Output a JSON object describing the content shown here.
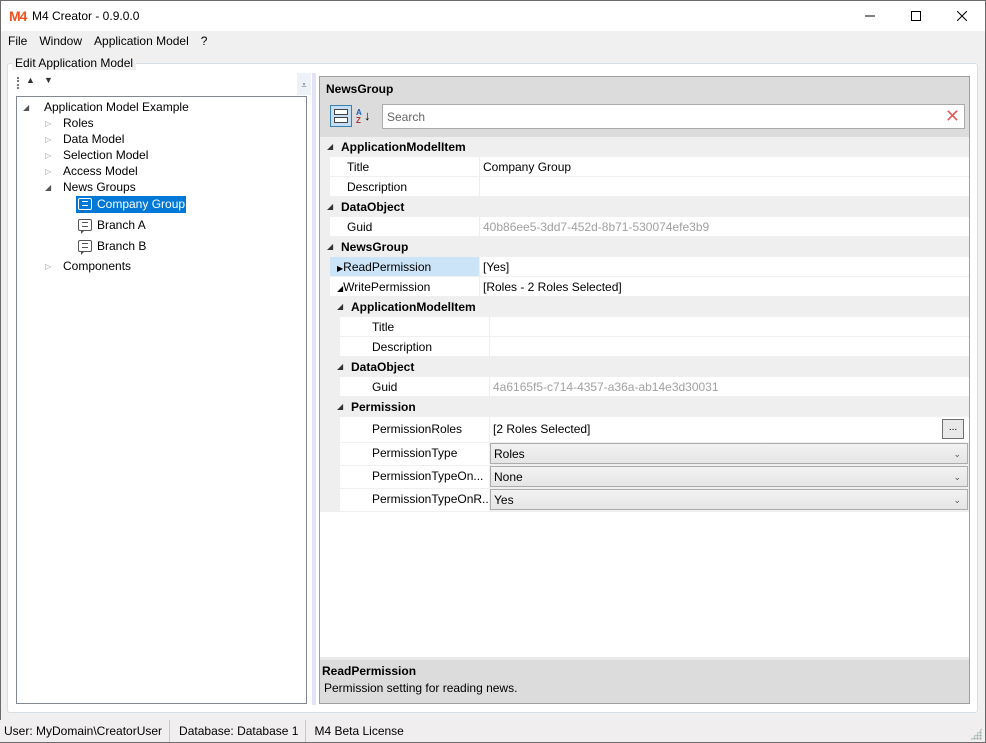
{
  "window": {
    "logo": "M4",
    "title": "M4 Creator - 0.9.0.0",
    "controls": {
      "minimize": "minimize-icon",
      "maximize": "maximize-icon",
      "close": "close-icon"
    }
  },
  "menu": [
    "File",
    "Window",
    "Application Model",
    "?"
  ],
  "group_label": "Edit Application Model",
  "tree_toolbar": {
    "up": "▲",
    "down": "▼",
    "overflow": "⩡"
  },
  "tree": {
    "root": "Application Model Example",
    "children": [
      "Roles",
      "Data Model",
      "Selection Model",
      "Access Model",
      "News Groups",
      "Components"
    ],
    "news_groups": [
      "Company Group",
      "Branch A",
      "Branch B"
    ],
    "selected": "Company Group"
  },
  "property_grid": {
    "title": "NewsGroup",
    "search_placeholder": "Search",
    "sections": {
      "ami": "ApplicationModelItem",
      "do": "DataObject",
      "ng": "NewsGroup",
      "ami2": "ApplicationModelItem",
      "do2": "DataObject",
      "perm": "Permission"
    },
    "props": {
      "title_name": "Title",
      "title_val": "Company Group",
      "desc_name": "Description",
      "desc_val": "",
      "guid_name": "Guid",
      "guid_val": "40b86ee5-3dd7-452d-8b71-530074efe3b9",
      "read_name": "ReadPermission",
      "read_val": "[Yes]",
      "write_name": "WritePermission",
      "write_val": "[Roles - 2 Roles Selected]",
      "w_title_name": "Title",
      "w_title_val": "",
      "w_desc_name": "Description",
      "w_desc_val": "",
      "w_guid_name": "Guid",
      "w_guid_val": "4a6165f5-c714-4357-a36a-ab14e3d30031",
      "roles_name": "PermissionRoles",
      "roles_val": "[2 Roles Selected]",
      "roles_button": "...",
      "ptype_name": "PermissionType",
      "ptype_val": "Roles",
      "pton_name": "PermissionTypeOn...",
      "pton_val": "None",
      "ptonr_name": "PermissionTypeOnR...",
      "ptonr_val": "Yes"
    },
    "description": {
      "title": "ReadPermission",
      "text": "Permission setting for reading news."
    }
  },
  "status": [
    "User: MyDomain\\CreatorUser",
    "Database: Database 1",
    "M4 Beta License"
  ]
}
